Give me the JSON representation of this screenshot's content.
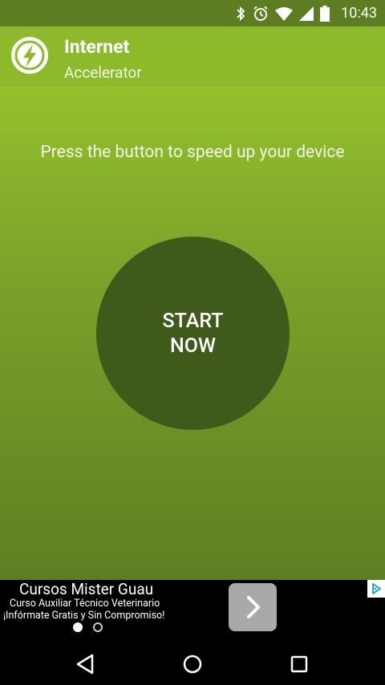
{
  "status_bar": {
    "time": "10:43",
    "icons": [
      "bluetooth-icon",
      "alarm-icon",
      "wifi-icon",
      "signal-icon",
      "battery-icon"
    ]
  },
  "app_bar": {
    "logo_icon": "lightning-bolt-icon",
    "title": "Internet",
    "subtitle": "Accelerator"
  },
  "main": {
    "instruction": "Press the button to speed up your device",
    "start_button": "START\n NOW"
  },
  "ad": {
    "title": "Cursos Mister Guau",
    "line1": "Curso Auxiliar Técnico Veterinario",
    "line2": "¡Infórmate Gratis y Sin Compromiso!",
    "arrow_icon": "chevron-right-icon",
    "choices_icon": "ad-choices-icon",
    "pages": 2,
    "active_page": 1
  },
  "nav_bar": {
    "buttons": [
      "back-icon",
      "home-icon",
      "recents-icon"
    ]
  },
  "colors": {
    "status_bar": "#5e7c21",
    "app_bar": "#8dba2a",
    "start_button": "#3f5a1b"
  }
}
